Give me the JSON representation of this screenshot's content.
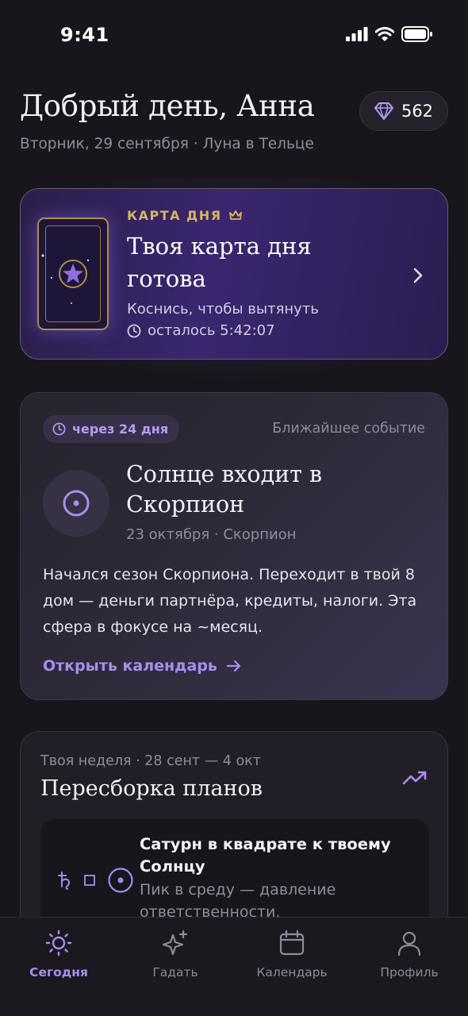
{
  "status": {
    "time": "9:41"
  },
  "header": {
    "greeting": "Добрый день, Анна",
    "subline": "Вторник, 29 сентября · Луна в Тельце",
    "gems": "562"
  },
  "day_card": {
    "label": "КАРТА ДНЯ",
    "title": "Твоя карта дня готова",
    "hint": "Коснись, чтобы вытянуть",
    "timer": "осталось 5:42:07"
  },
  "event": {
    "pill": "через 24 дня",
    "nearest": "Ближайшее событие",
    "title": "Солнце входит в Скорпион",
    "meta": "23 октября · Скорпион",
    "description": "Начался сезон Скорпиона. Переходит в твой 8 дом — деньги партнёра, кредиты, налоги. Эта сфера в фокусе на ~месяц.",
    "link": "Открыть календарь"
  },
  "week": {
    "meta": "Твоя неделя · 28 сент — 4 окт",
    "title": "Пересборка планов",
    "transit": {
      "title": "Сатурн в квадрате к твоему Солнцу",
      "subtitle": "Пик в среду — давление ответственности."
    }
  },
  "tabs": [
    {
      "label": "Сегодня",
      "icon": "sun-icon",
      "active": true
    },
    {
      "label": "Гадать",
      "icon": "sparkle-icon",
      "active": false
    },
    {
      "label": "Календарь",
      "icon": "calendar-icon",
      "active": false
    },
    {
      "label": "Профиль",
      "icon": "person-icon",
      "active": false
    }
  ],
  "colors": {
    "accent": "#a98df0",
    "gold": "#d9b460",
    "background": "#17161c"
  }
}
